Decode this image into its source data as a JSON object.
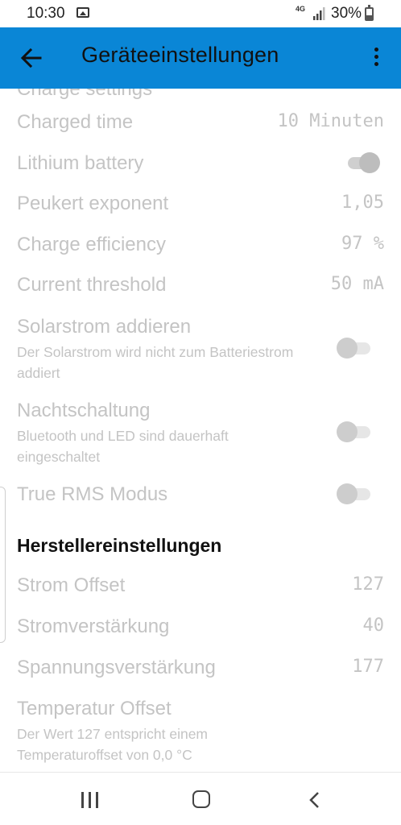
{
  "status_bar": {
    "time": "10:30",
    "network": "4G",
    "battery_percent": "30%"
  },
  "app_bar": {
    "title": "Geräteeinstellungen"
  },
  "settings": {
    "partial_title": "Charge settings",
    "charged_time": {
      "label": "Charged time",
      "value": "10 Minuten"
    },
    "lithium_battery": {
      "label": "Lithium battery",
      "enabled": true
    },
    "peukert_exponent": {
      "label": "Peukert exponent",
      "value": "1,05"
    },
    "charge_efficiency": {
      "label": "Charge efficiency",
      "value": "97 %"
    },
    "current_threshold": {
      "label": "Current threshold",
      "value": "50 mA"
    },
    "solarstrom_addieren": {
      "label": "Solarstrom addieren",
      "summary": "Der Solarstrom wird nicht zum Batteriestrom addiert",
      "enabled": false
    },
    "nachtschaltung": {
      "label": "Nachtschaltung",
      "summary": "Bluetooth und LED sind dauerhaft eingeschaltet",
      "enabled": false
    },
    "true_rms_modus": {
      "label": "True RMS Modus",
      "enabled": false
    }
  },
  "manufacturer_section": {
    "title": "Herstellereinstellungen",
    "strom_offset": {
      "label": "Strom Offset",
      "value": "127"
    },
    "stromverstaerkung": {
      "label": "Stromverstärkung",
      "value": "40"
    },
    "spannungsverstaerkung": {
      "label": "Spannungsverstärkung",
      "value": "177"
    },
    "temperatur_offset": {
      "label": "Temperatur Offset",
      "summary": "Der Wert 127 entspricht einem Temperaturoffset von 0,0 °C"
    }
  },
  "colors": {
    "app_bar": "#0a86d6",
    "disabled_text": "#c4c4c4",
    "section_title": "#111111"
  },
  "icons": {
    "back": "arrow-left-icon",
    "menu": "more-vert-icon",
    "nav_recent": "recent-apps-icon",
    "nav_home": "home-icon",
    "nav_back": "back-chevron-icon"
  }
}
